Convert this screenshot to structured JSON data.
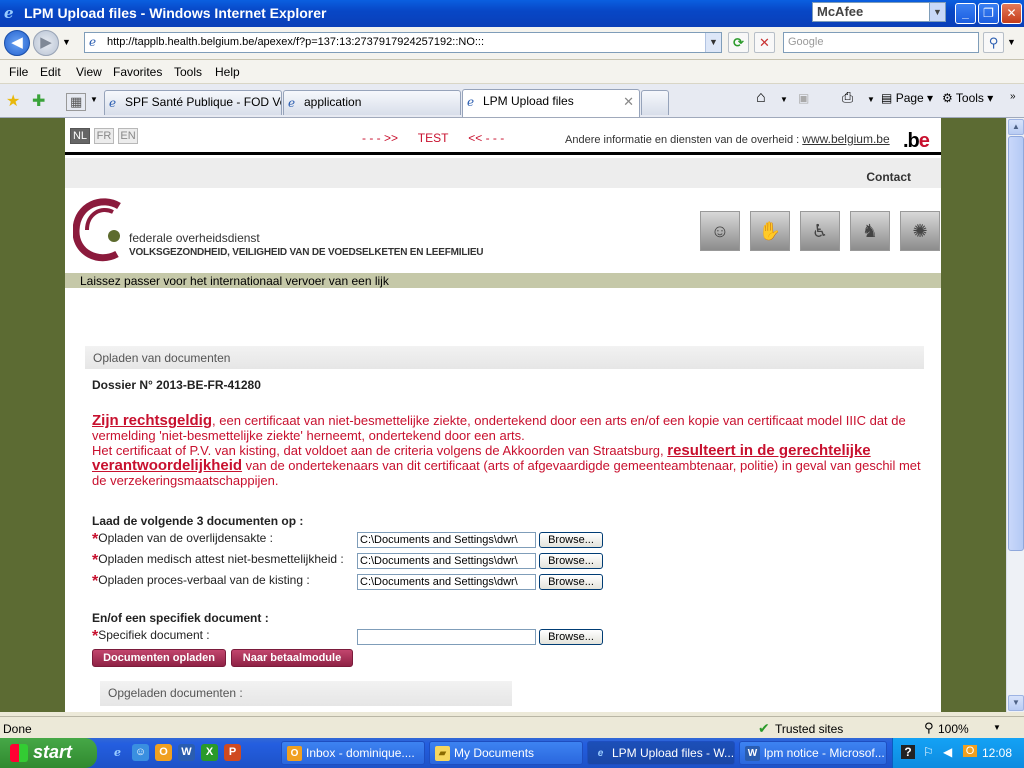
{
  "window": {
    "title": "LPM Upload files - Windows Internet Explorer",
    "mcafee": "McAfee"
  },
  "address": {
    "url": "http://tapplb.health.belgium.be/apexex/f?p=137:13:2737917924257192::NO:::",
    "search_placeholder": "Google"
  },
  "menu": [
    "File",
    "Edit",
    "View",
    "Favorites",
    "Tools",
    "Help"
  ],
  "tabs": [
    {
      "label": "SPF Santé Publique - FOD Vol..."
    },
    {
      "label": "application"
    },
    {
      "label": "LPM Upload files"
    }
  ],
  "toolbar": {
    "page": "Page",
    "tools": "Tools"
  },
  "site": {
    "languages": [
      "NL",
      "FR",
      "EN"
    ],
    "test_label": "- - - >>      TEST      << - - -",
    "other_info": "Andere informatie en diensten van de overheid :",
    "belgium_link": "www.belgium.be",
    "be_logo_a": ".b",
    "be_logo_b": "e",
    "contact": "Contact",
    "fod_line1": "federale overheidsdienst",
    "fod_line2": "VOLKSGEZONDHEID, VEILIGHEID VAN DE VOEDSELKETEN EN LEEFMILIEU",
    "banner": "Laissez passer voor het internationaal vervoer van een lijk"
  },
  "upload": {
    "section_title": "Opladen van documenten",
    "dossier": "Dossier N° 2013-BE-FR-41280",
    "notice_bold1": "Zijn rechtsgeldig",
    "notice_text1": ", een certificaat van niet-besmettelijke ziekte, ondertekend door een arts en/of een kopie van certificaat model IIIC dat de vermelding 'niet-besmettelijke ziekte' herneemt, ondertekend door een arts.",
    "notice_text2": "Het certificaat of P.V. van kisting, dat voldoet aan de criteria volgens de Akkoorden van Straatsburg, ",
    "notice_bold2": "resulteert in de gerechtelijke verantwoordelijkheid",
    "notice_text3": " van de ondertekenaars van dit certificaat (arts of afgevaardigde gemeenteambtenaar, politie) in geval van geschil met de verzekeringsmaatschappijen.",
    "load_heading": "Laad de volgende 3 documenten op :",
    "rows": [
      {
        "label": "Opladen van de overlijdensakte :",
        "value": "C:\\Documents and Settings\\dwr\\"
      },
      {
        "label": "Opladen medisch attest niet-besmettelijkheid :",
        "value": "C:\\Documents and Settings\\dwr\\"
      },
      {
        "label": "Opladen proces-verbaal van de kisting :",
        "value": "C:\\Documents and Settings\\dwr\\"
      }
    ],
    "specific_heading": "En/of een specifiek document :",
    "specific_label": "Specifiek document :",
    "specific_value": "",
    "browse_label": "Browse...",
    "upload_button": "Documenten opladen",
    "payment_button": "Naar betaalmodule",
    "uploaded_title": "Opgeladen documenten :"
  },
  "status": {
    "left": "Done",
    "zone": "Trusted sites",
    "zoom": "100%"
  },
  "taskbar": {
    "start": "start",
    "items": [
      {
        "label": "Inbox - dominique...."
      },
      {
        "label": "My Documents"
      },
      {
        "label": "LPM Upload files - W..."
      },
      {
        "label": "lpm notice - Microsof..."
      }
    ],
    "clock": "12:08"
  }
}
